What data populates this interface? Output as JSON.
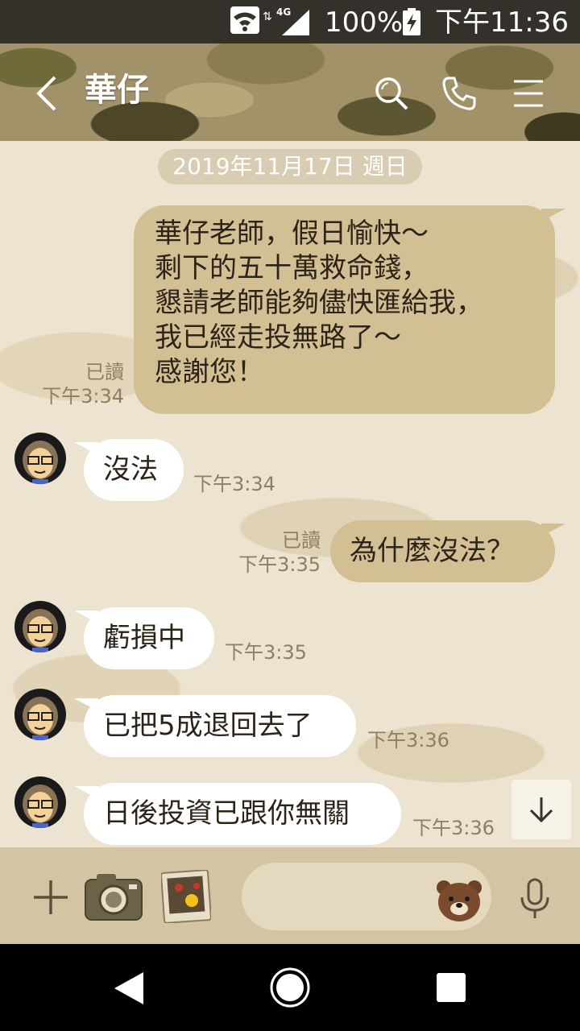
{
  "status_bar": {
    "network": "4G",
    "battery": "100%",
    "time": "下午11:36"
  },
  "header": {
    "title": "華仔",
    "icons": [
      "back-icon",
      "search-icon",
      "phone-icon",
      "menu-icon"
    ]
  },
  "chat": {
    "date": "2019年11月17日 週日",
    "messages": [
      {
        "direction": "out",
        "text": "華仔老師，假日愉快～\n剩下的五十萬救命錢，\n懇請老師能夠儘快匯給我，\n我已經走投無路了～\n感謝您！",
        "read": "已讀",
        "time": "下午3:34"
      },
      {
        "direction": "in",
        "text": "沒法",
        "time": "下午3:34"
      },
      {
        "direction": "out",
        "text": "為什麼沒法？",
        "read": "已讀",
        "time": "下午3:35"
      },
      {
        "direction": "in",
        "text": "虧損中",
        "time": "下午3:35"
      },
      {
        "direction": "in",
        "text": "已把5成退回去了",
        "time": "下午3:36"
      },
      {
        "direction": "in",
        "text": "日後投資已跟你無關",
        "time": "下午3:36"
      }
    ]
  },
  "input_bar": {
    "placeholder": "",
    "icons": [
      "plus-icon",
      "camera-icon",
      "photo-icon",
      "sticker-icon",
      "mic-icon"
    ]
  },
  "colors": {
    "outgoing_bubble": "#d3bf94",
    "incoming_bubble": "#ffffff",
    "chat_background": "#ece3d0",
    "meta_text": "#8d7f66"
  }
}
